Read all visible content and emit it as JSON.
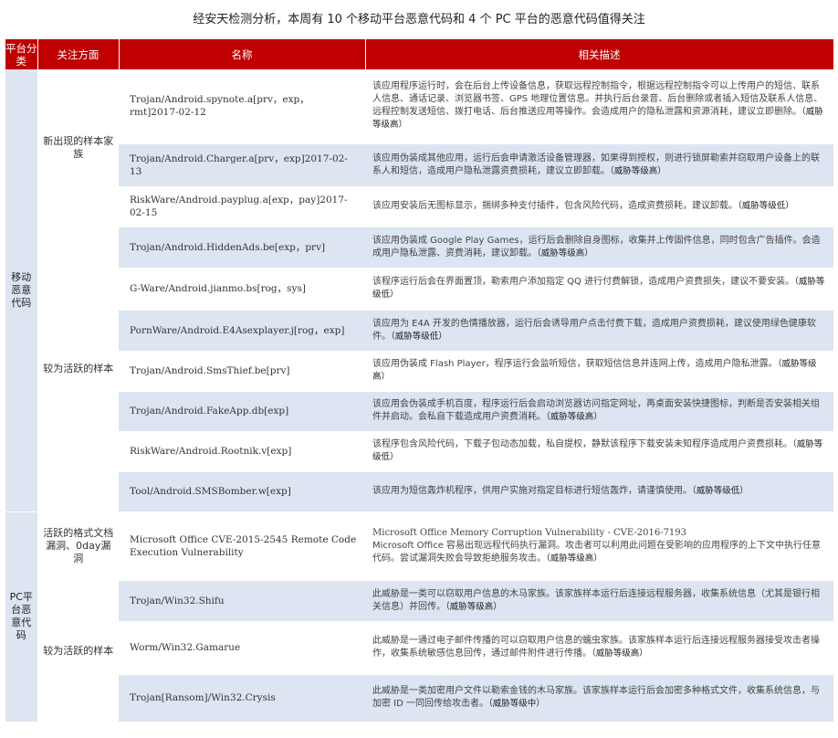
{
  "title": "经安天检测分析，本周有 10 个移动平台恶意代码和 4 个 PC 平台的恶意代码值得关注",
  "headers": {
    "category": "平台分类",
    "aspect": "关注方面",
    "name": "名称",
    "description": "相关描述"
  },
  "mobile": {
    "category": "移动恶意代码",
    "new_family": "新出现的样本家族",
    "active": "较为活跃的样本",
    "rows": [
      {
        "name": "Trojan/Android.spynote.a[prv，exp，rmt]2017-02-12",
        "desc": "该应用程序运行时，会在后台上传设备信息，获取远程控制指令，根据远程控制指令可以上传用户的短信、联系人信息、通话记录、浏览器书签、GPS 地理位置信息。并执行后台录音、后台删除或者插入短信及联系人信息、远程控制发送短信、拨打电话、后台推送应用等操作。会造成用户的隐私泄露和资源消耗，建议立即删除。",
        "level": "（威胁等级高）"
      },
      {
        "name": "Trojan/Android.Charger.a[prv，exp]2017-02-13",
        "desc": "该应用伪装成其他应用，运行后会申请激活设备管理器，如果得到授权，则进行锁屏勒索并窃取用户设备上的联系人和短信，造成用户隐私泄露资费损耗，建议立即卸载。",
        "level": "（威胁等级高）"
      },
      {
        "name": "RiskWare/Android.payplug.a[exp，pay]2017-02-15",
        "desc": "该应用安装后无图标显示，捆绑多种支付插件，包含风险代码，造成资费损耗，建议卸载。",
        "level": "（威胁等级低）"
      },
      {
        "name": "Trojan/Android.HiddenAds.be[exp，prv]",
        "desc": "该应用伪装成 Google Play Games，运行后会删除自身图标，收集并上传固件信息，同时包含广告插件。会造成用户隐私泄露、资费消耗，建议卸载。",
        "level": "（威胁等级高）"
      },
      {
        "name": "G-Ware/Android.jianmo.bs[rog，sys]",
        "desc": "该程序运行后会在界面置顶，勒索用户添加指定 QQ 进行付费解锁，造成用户资费损失，建议不要安装。",
        "level": "（威胁等级低）"
      },
      {
        "name": "PornWare/Android.E4Asexplayer.j[rog，exp]",
        "desc": "该应用为 E4A 开发的色情播放器，运行后会诱导用户点击付费下载，造成用户资费损耗，建议使用绿色健康软件。",
        "level": "（威胁等级低）"
      },
      {
        "name": "Trojan/Android.SmsThief.be[prv]",
        "desc": "该应用伪装成 Flash Player，程序运行会监听短信，获取短信信息并连网上传，造成用户隐私泄露。",
        "level": "（威胁等级高）"
      },
      {
        "name": "Trojan/Android.FakeApp.db[exp]",
        "desc": "该应用会伪装成手机百度，程序运行后会启动浏览器访问指定网址，再桌面安装快捷图标，判断是否安装相关组件并启动。会私自下载造成用户资费消耗。",
        "level": "（威胁等级高）"
      },
      {
        "name": "RiskWare/Android.Rootnik.v[exp]",
        "desc": "该程序包含风险代码，下载子包动态加载，私自提权，静默该程序下载安装未知程序造成用户资费损耗。",
        "level": "（威胁等级低）"
      },
      {
        "name": "Tool/Android.SMSBomber.w[exp]",
        "desc": "该应用为短信轰炸机程序，供用户实施对指定目标进行短信轰炸，请谨慎使用。",
        "level": "（威胁等级低）"
      }
    ]
  },
  "pc": {
    "category": "PC平台恶意代码",
    "doc_vuln": "活跃的格式文档漏洞、0day漏洞",
    "active": "较为活跃的样本",
    "rows": [
      {
        "name": "Microsoft Office CVE-2015-2545 Remote Code Execution Vulnerability",
        "desc_head": "Microsoft Office Memory Corruption Vulnerability - CVE-2016-7193",
        "desc": "Microsoft Office 容易出现远程代码执行漏洞。攻击者可以利用此问题在受影响的应用程序的上下文中执行任意代码。尝试漏洞失败会导致拒绝服务攻击。",
        "level": "（威胁等级高）"
      },
      {
        "name": "Trojan/Win32.Shifu",
        "desc": "此威胁是一类可以窃取用户信息的木马家族。该家族样本运行后连接远程服务器，收集系统信息（尤其是银行相关信息）并回传。",
        "level": "（威胁等级高）"
      },
      {
        "name": "Worm/Win32.Gamarue",
        "desc": "此威胁是一通过电子邮件传播的可以窃取用户信息的蠕虫家族。该家族样本运行后连接远程服务器接受攻击者操作，收集系统敏感信息回传，通过邮件附件进行传播。",
        "level": "（威胁等级高）"
      },
      {
        "name": "Trojan[Ransom]/Win32.Crysis",
        "desc": "此威胁是一类加密用户文件以勒索金钱的木马家族。该家族样本运行后会加密多种格式文件，收集系统信息，与加密 ID 一同回传给攻击者。",
        "level": "（威胁等级中）"
      }
    ]
  },
  "colors": {
    "header_bg": "#c00000",
    "band_bg": "#dce5f1",
    "text": "#444444"
  }
}
